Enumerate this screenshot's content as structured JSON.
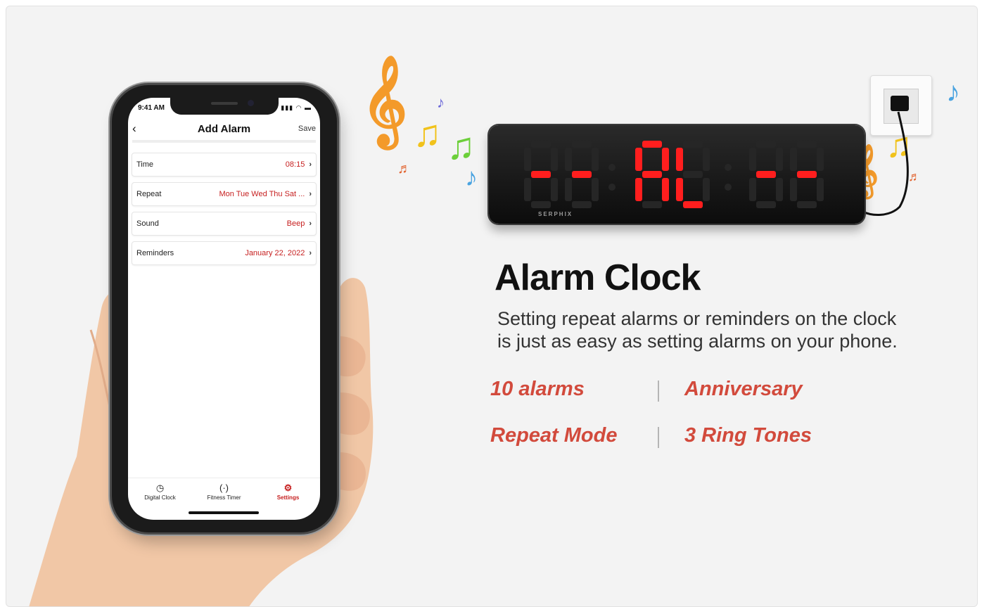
{
  "phone": {
    "status_time": "9:41 AM",
    "status_icons": "▮▮▮ ◠ ▬",
    "back_icon": "chevron-left-icon",
    "title": "Add Alarm",
    "save_label": "Save",
    "rows": [
      {
        "label": "Time",
        "value": "08:15"
      },
      {
        "label": "Repeat",
        "value": "Mon Tue Wed Thu Sat ..."
      },
      {
        "label": "Sound",
        "value": "Beep"
      },
      {
        "label": "Reminders",
        "value": "January 22, 2022"
      }
    ],
    "tabs": [
      {
        "label": "Digital Clock",
        "icon": "clock-icon",
        "glyph": "◷"
      },
      {
        "label": "Fitness Timer",
        "icon": "timer-icon",
        "glyph": "(·)"
      },
      {
        "label": "Settings",
        "icon": "gear-icon",
        "glyph": "⚙"
      }
    ],
    "active_tab": "Settings"
  },
  "clock": {
    "display": "--AL--",
    "brand": "SERPHIX",
    "digit_color": "#ff1e1e"
  },
  "content": {
    "headline": "Alarm Clock",
    "description_line1": "Setting repeat alarms or reminders on the clock",
    "description_line2": "is just as easy as setting alarms on your phone.",
    "features": [
      "10 alarms",
      "Anniversary",
      "Repeat Mode",
      "3 Ring Tones"
    ],
    "accent_color": "#d24a3c"
  }
}
